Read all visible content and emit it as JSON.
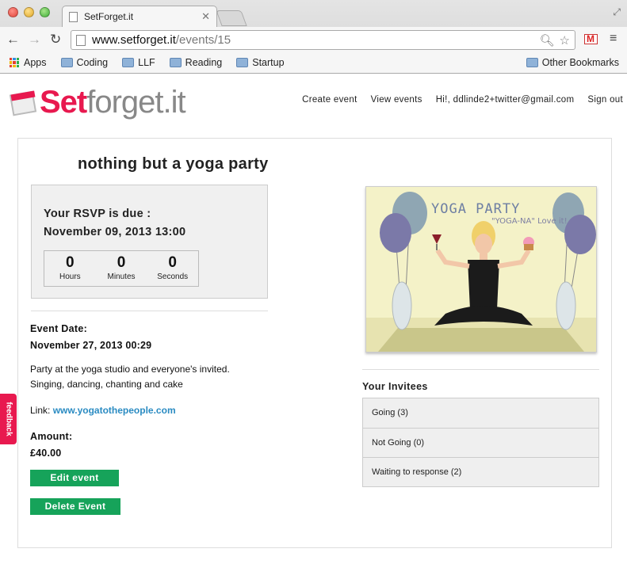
{
  "browser": {
    "tab_title": "SetForget.it",
    "url_host": "www.setforget.it",
    "url_path": "/events/15",
    "bookmarks": [
      "Apps",
      "Coding",
      "LLF",
      "Reading",
      "Startup"
    ],
    "other_bookmarks": "Other Bookmarks"
  },
  "site": {
    "logo_part1": "Set",
    "logo_part2": "forget.it",
    "nav": {
      "create": "Create event",
      "view": "View events",
      "greeting": "Hi!, ddlinde2+twitter@gmail.com",
      "signout": "Sign out"
    },
    "feedback": "feedback"
  },
  "event": {
    "title": "nothing but a yoga party",
    "rsvp_label": "Your RSVP is due :",
    "rsvp_date": "November 09, 2013 13:00",
    "countdown": {
      "hours": "0",
      "hours_label": "Hours",
      "minutes": "0",
      "minutes_label": "Minutes",
      "seconds": "0",
      "seconds_label": "Seconds"
    },
    "date_label": "Event Date:",
    "date_value": "November 27, 2013 00:29",
    "description_line1": "Party at the yoga studio and everyone's invited.",
    "description_line2": "Singing, dancing, chanting and cake",
    "link_label": "Link:",
    "link_text": "www.yogatothepeople.com",
    "amount_label": "Amount:",
    "amount_value": "£40.00",
    "edit_button": "Edit event",
    "delete_button": "Delete Event",
    "poster_title": "YOGA PARTY",
    "poster_tagline": "\"YOGA-NA\" Love it!"
  },
  "invitees": {
    "title": "Your Invitees",
    "going": "Going (3)",
    "not_going": "Not Going (0)",
    "waiting": "Waiting to response (2)"
  },
  "colors": {
    "brand_pink": "#e8194f",
    "button_green": "#16a35a",
    "link_blue": "#2a8bc2"
  }
}
